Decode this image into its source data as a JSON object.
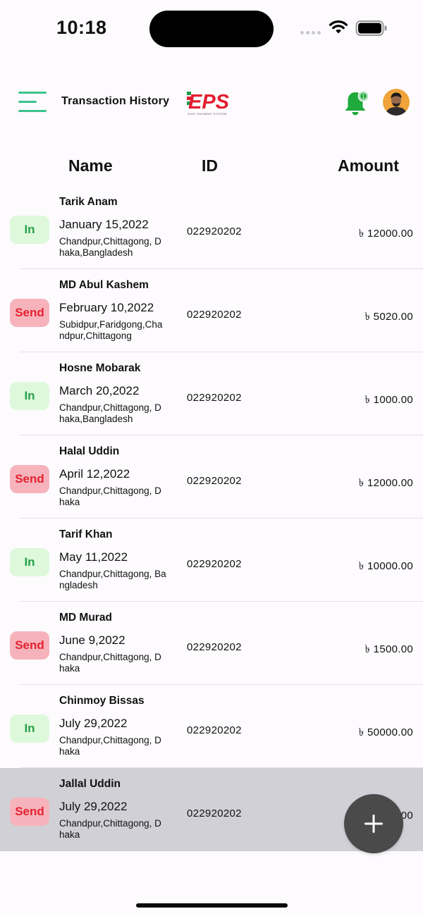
{
  "status_bar": {
    "time": "10:18"
  },
  "header": {
    "title": "Transaction History",
    "logo_text": "EPS",
    "logo_tagline": "EASY PAYMENT SYSTEM",
    "notification_count": "1"
  },
  "table": {
    "columns": {
      "name": "Name",
      "id": "ID",
      "amount": "Amount"
    },
    "rows": [
      {
        "type": "In",
        "name": "Tarik Anam",
        "date": "January 15,2022",
        "address": "Chandpur,Chittagong, Dhaka,Bangladesh",
        "id": "022920202",
        "amount": "৳ 12000.00"
      },
      {
        "type": "Send",
        "name": "MD Abul Kashem",
        "date": "February 10,2022",
        "address": "Subidpur,Faridgong,Chandpur,Chittagong",
        "id": "022920202",
        "amount": "৳ 5020.00"
      },
      {
        "type": "In",
        "name": "Hosne Mobarak",
        "date": "March 20,2022",
        "address": "Chandpur,Chittagong, Dhaka,Bangladesh",
        "id": "022920202",
        "amount": "৳ 1000.00"
      },
      {
        "type": "Send",
        "name": "Halal Uddin",
        "date": "April 12,2022",
        "address": "Chandpur,Chittagong, Dhaka",
        "id": "022920202",
        "amount": "৳ 12000.00"
      },
      {
        "type": "In",
        "name": "Tarif Khan",
        "date": "May 11,2022",
        "address": "Chandpur,Chittagong, Bangladesh",
        "id": "022920202",
        "amount": "৳ 10000.00"
      },
      {
        "type": "Send",
        "name": "MD Murad",
        "date": "June 9,2022",
        "address": "Chandpur,Chittagong, Dhaka",
        "id": "022920202",
        "amount": "৳ 1500.00"
      },
      {
        "type": "In",
        "name": "Chinmoy Bissas",
        "date": "July 29,2022",
        "address": "Chandpur,Chittagong, Dhaka",
        "id": "022920202",
        "amount": "৳ 50000.00"
      },
      {
        "type": "Send",
        "name": "Jallal Uddin",
        "date": "July 29,2022",
        "address": "Chandpur,Chittagong, Dhaka",
        "id": "022920202",
        "amount": "৳ 12000.00",
        "selected": true
      }
    ]
  },
  "colors": {
    "in_badge_bg": "#def8dc",
    "in_badge_text": "#25a048",
    "send_badge_bg": "#f7b3bc",
    "send_badge_text": "#e4222f",
    "menu_accent": "#3cc38b",
    "bell": "#1faa3b",
    "fab": "#4a4a4b"
  },
  "icons": {
    "menu": "hamburger-menu-icon",
    "notification": "bell-icon",
    "add": "plus-icon",
    "wifi": "wifi-icon",
    "battery": "battery-icon"
  }
}
